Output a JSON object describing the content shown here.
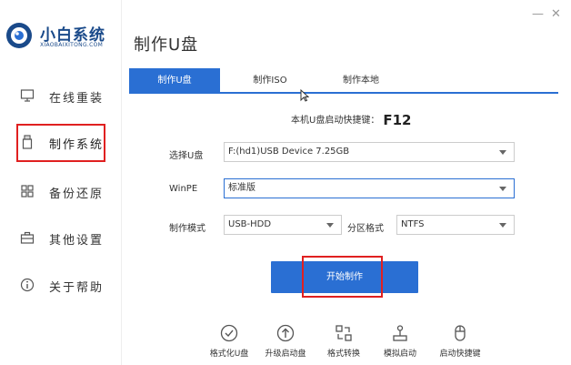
{
  "app": {
    "name": "小白系统",
    "subtitle": "XIAOBAIXITONG.COM",
    "page_title": "制作U盘"
  },
  "window_controls": {
    "minimize": "—",
    "close": "✕"
  },
  "sidebar": {
    "items": [
      {
        "label": "在线重装",
        "icon": "monitor-icon"
      },
      {
        "label": "制作系统",
        "icon": "usb-drive-icon"
      },
      {
        "label": "备份还原",
        "icon": "grid-icon"
      },
      {
        "label": "其他设置",
        "icon": "toolbox-icon"
      },
      {
        "label": "关于帮助",
        "icon": "info-icon"
      }
    ],
    "active_index": 1
  },
  "tabs": [
    {
      "label": "制作U盘",
      "active": true
    },
    {
      "label": "制作ISO",
      "active": false
    },
    {
      "label": "制作本地",
      "active": false
    }
  ],
  "shortcut": {
    "label": "本机U盘启动快捷键：",
    "key": "F12"
  },
  "form": {
    "usb_label": "选择U盘",
    "usb_value": "F:(hd1)USB Device 7.25GB",
    "winpe_label": "WinPE",
    "winpe_value": "标准版",
    "mode_label": "制作模式",
    "mode_value": "USB-HDD",
    "partition_label": "分区格式",
    "partition_value": "NTFS"
  },
  "start_button": "开始制作",
  "tools": [
    {
      "label": "格式化U盘",
      "icon": "check-circle-icon"
    },
    {
      "label": "升级启动盘",
      "icon": "upgrade-arrow-icon"
    },
    {
      "label": "格式转换",
      "icon": "convert-icon"
    },
    {
      "label": "模拟启动",
      "icon": "joystick-icon"
    },
    {
      "label": "启动快捷键",
      "icon": "mouse-icon"
    }
  ],
  "colors": {
    "accent": "#2a6fd3",
    "highlight": "#e02020",
    "brand": "#1a4a8a"
  }
}
